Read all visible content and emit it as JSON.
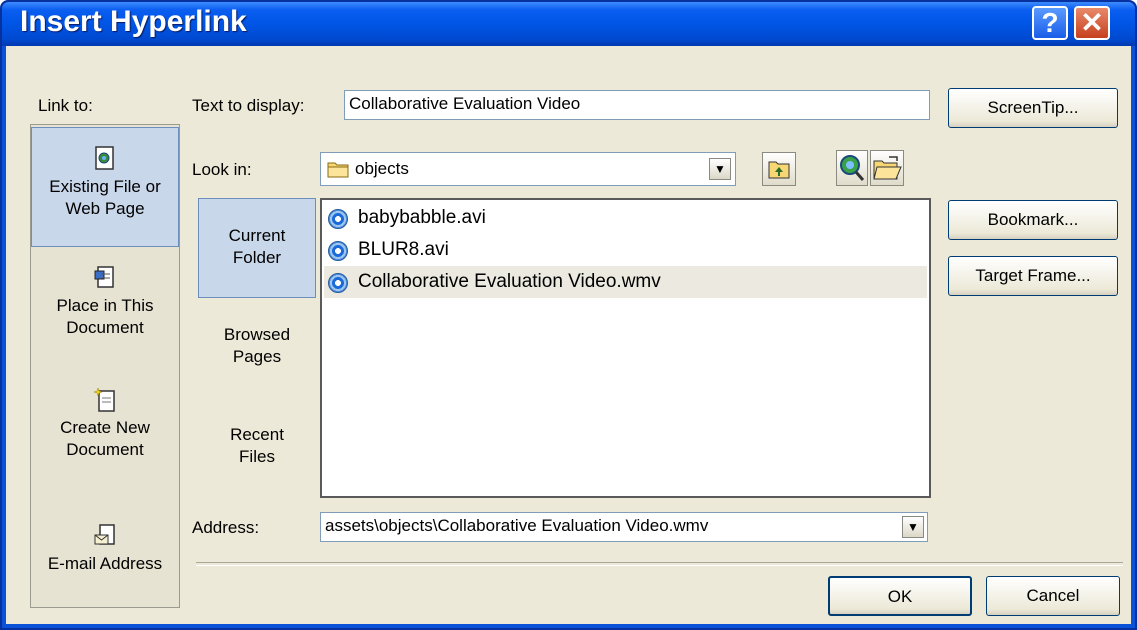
{
  "window": {
    "title": "Insert Hyperlink",
    "help_glyph": "?",
    "close_glyph": "✕"
  },
  "link_to": {
    "label": "Link to:",
    "items": [
      {
        "label_line1": "Existing File or",
        "label_line2": "Web Page",
        "icon": "existing-file-icon",
        "selected": true
      },
      {
        "label_line1": "Place in This",
        "label_line2": "Document",
        "icon": "place-in-document-icon",
        "selected": false
      },
      {
        "label_line1": "Create New",
        "label_line2": "Document",
        "icon": "create-new-document-icon",
        "selected": false
      },
      {
        "label_line1": "E-mail Address",
        "label_line2": "",
        "icon": "email-address-icon",
        "selected": false
      }
    ]
  },
  "text_to_display": {
    "label": "Text to display:",
    "value": "Collaborative Evaluation Video"
  },
  "look_in": {
    "label": "Look in:",
    "value": "objects",
    "folder_icon": "folder-icon"
  },
  "toolbar": {
    "up_folder_icon": "up-one-folder-icon",
    "browse_web_icon": "browse-web-icon",
    "browse_file_icon": "browse-file-icon"
  },
  "nav": [
    {
      "line1": "Current",
      "line2": "Folder",
      "selected": true
    },
    {
      "line1": "Browsed",
      "line2": "Pages",
      "selected": false
    },
    {
      "line1": "Recent",
      "line2": "Files",
      "selected": false
    }
  ],
  "files": [
    {
      "name": "babybabble.avi",
      "selected": false
    },
    {
      "name": "BLUR8.avi",
      "selected": false
    },
    {
      "name": "Collaborative Evaluation Video.wmv",
      "selected": true
    }
  ],
  "address": {
    "label": "Address:",
    "value": "assets\\objects\\Collaborative Evaluation Video.wmv"
  },
  "buttons": {
    "screentip": "ScreenTip...",
    "bookmark": "Bookmark...",
    "target_frame": "Target Frame...",
    "ok": "OK",
    "cancel": "Cancel"
  },
  "colors": {
    "title_bar": "#0055e5",
    "dialog_bg": "#ece9d8",
    "selection": "#c9d7ea"
  }
}
